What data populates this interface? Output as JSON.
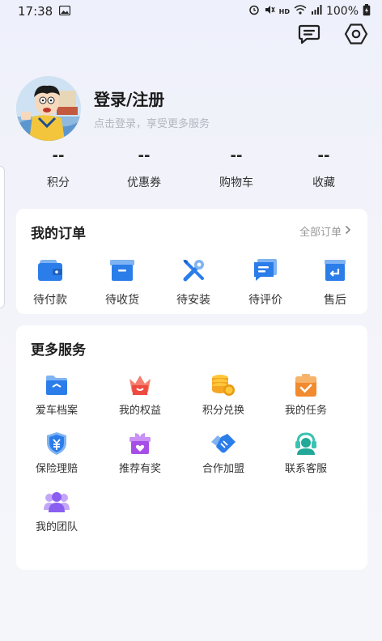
{
  "status_bar": {
    "time": "17:38",
    "battery": "100%"
  },
  "profile": {
    "title": "登录/注册",
    "subtitle": "点击登录，享受更多服务"
  },
  "stats": [
    {
      "value": "--",
      "label": "积分"
    },
    {
      "value": "--",
      "label": "优惠券"
    },
    {
      "value": "--",
      "label": "购物车"
    },
    {
      "value": "--",
      "label": "收藏"
    }
  ],
  "orders": {
    "title": "我的订单",
    "all_label": "全部订单",
    "items": [
      {
        "label": "待付款",
        "icon": "wallet-icon"
      },
      {
        "label": "待收货",
        "icon": "box-icon"
      },
      {
        "label": "待安装",
        "icon": "tools-icon"
      },
      {
        "label": "待评价",
        "icon": "comment-icon"
      },
      {
        "label": "售后",
        "icon": "return-icon"
      }
    ]
  },
  "services": {
    "title": "更多服务",
    "items": [
      {
        "label": "爱车档案",
        "icon": "folder-icon"
      },
      {
        "label": "我的权益",
        "icon": "crown-icon"
      },
      {
        "label": "积分兑换",
        "icon": "coins-icon"
      },
      {
        "label": "我的任务",
        "icon": "task-icon"
      },
      {
        "label": "保险理赔",
        "icon": "shield-yen-icon"
      },
      {
        "label": "推荐有奖",
        "icon": "gift-icon"
      },
      {
        "label": "合作加盟",
        "icon": "handshake-icon"
      },
      {
        "label": "联系客服",
        "icon": "headset-icon"
      },
      {
        "label": "我的团队",
        "icon": "team-icon"
      }
    ]
  },
  "colors": {
    "accent_blue": "#2b7de9",
    "orange": "#f28a2e",
    "red": "#ef4a3f",
    "purple": "#8a5ef0"
  }
}
